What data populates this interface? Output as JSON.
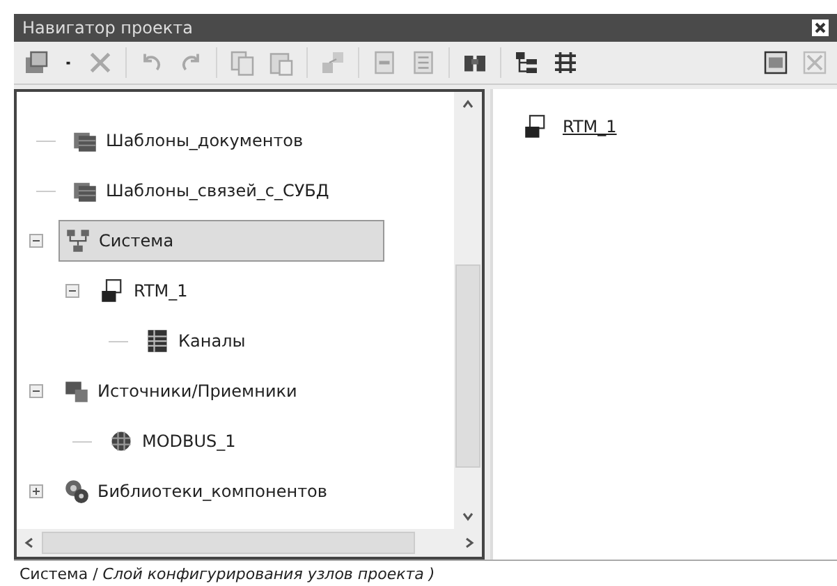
{
  "window": {
    "title": "Навигатор проекта"
  },
  "toolbar": [
    {
      "kind": "new",
      "disabled": false
    },
    {
      "kind": "dropdown",
      "disabled": false
    },
    {
      "kind": "delete",
      "disabled": true
    },
    {
      "kind": "sep"
    },
    {
      "kind": "undo",
      "disabled": true
    },
    {
      "kind": "redo",
      "disabled": true
    },
    {
      "kind": "sep"
    },
    {
      "kind": "copy",
      "disabled": true
    },
    {
      "kind": "paste",
      "disabled": true
    },
    {
      "kind": "sep"
    },
    {
      "kind": "link",
      "disabled": true
    },
    {
      "kind": "sep"
    },
    {
      "kind": "import",
      "disabled": true
    },
    {
      "kind": "export",
      "disabled": true
    },
    {
      "kind": "sep"
    },
    {
      "kind": "find",
      "disabled": false
    },
    {
      "kind": "sep"
    },
    {
      "kind": "tree",
      "disabled": false
    },
    {
      "kind": "grid",
      "disabled": false
    },
    {
      "kind": "spacer"
    },
    {
      "kind": "props",
      "disabled": false
    },
    {
      "kind": "close",
      "disabled": true
    }
  ],
  "tree": [
    {
      "label": "Шаблоны_документов",
      "kind": "stack",
      "selected": false
    },
    {
      "label": "Шаблоны_связей_с_СУБД",
      "kind": "stack",
      "selected": false
    },
    {
      "label": "Система",
      "kind": "network",
      "selected": true,
      "expanded": true,
      "children": [
        {
          "label": "RTM_1",
          "kind": "node",
          "selected": false,
          "expanded": true,
          "children": [
            {
              "label": "Каналы",
              "kind": "table",
              "selected": false
            }
          ]
        }
      ]
    },
    {
      "label": "Источники/Приемники",
      "kind": "devices",
      "selected": false,
      "expanded": true,
      "children": [
        {
          "label": "MODBUS_1",
          "kind": "chip",
          "selected": false
        }
      ]
    },
    {
      "label": "Библиотеки_компонентов",
      "kind": "gears",
      "selected": false,
      "expanded": false
    }
  ],
  "content": {
    "items": [
      {
        "label": "RTM_1",
        "kind": "node"
      }
    ]
  },
  "status_bar": "Система / *Слой конфигурирования узлов проекта )*"
}
